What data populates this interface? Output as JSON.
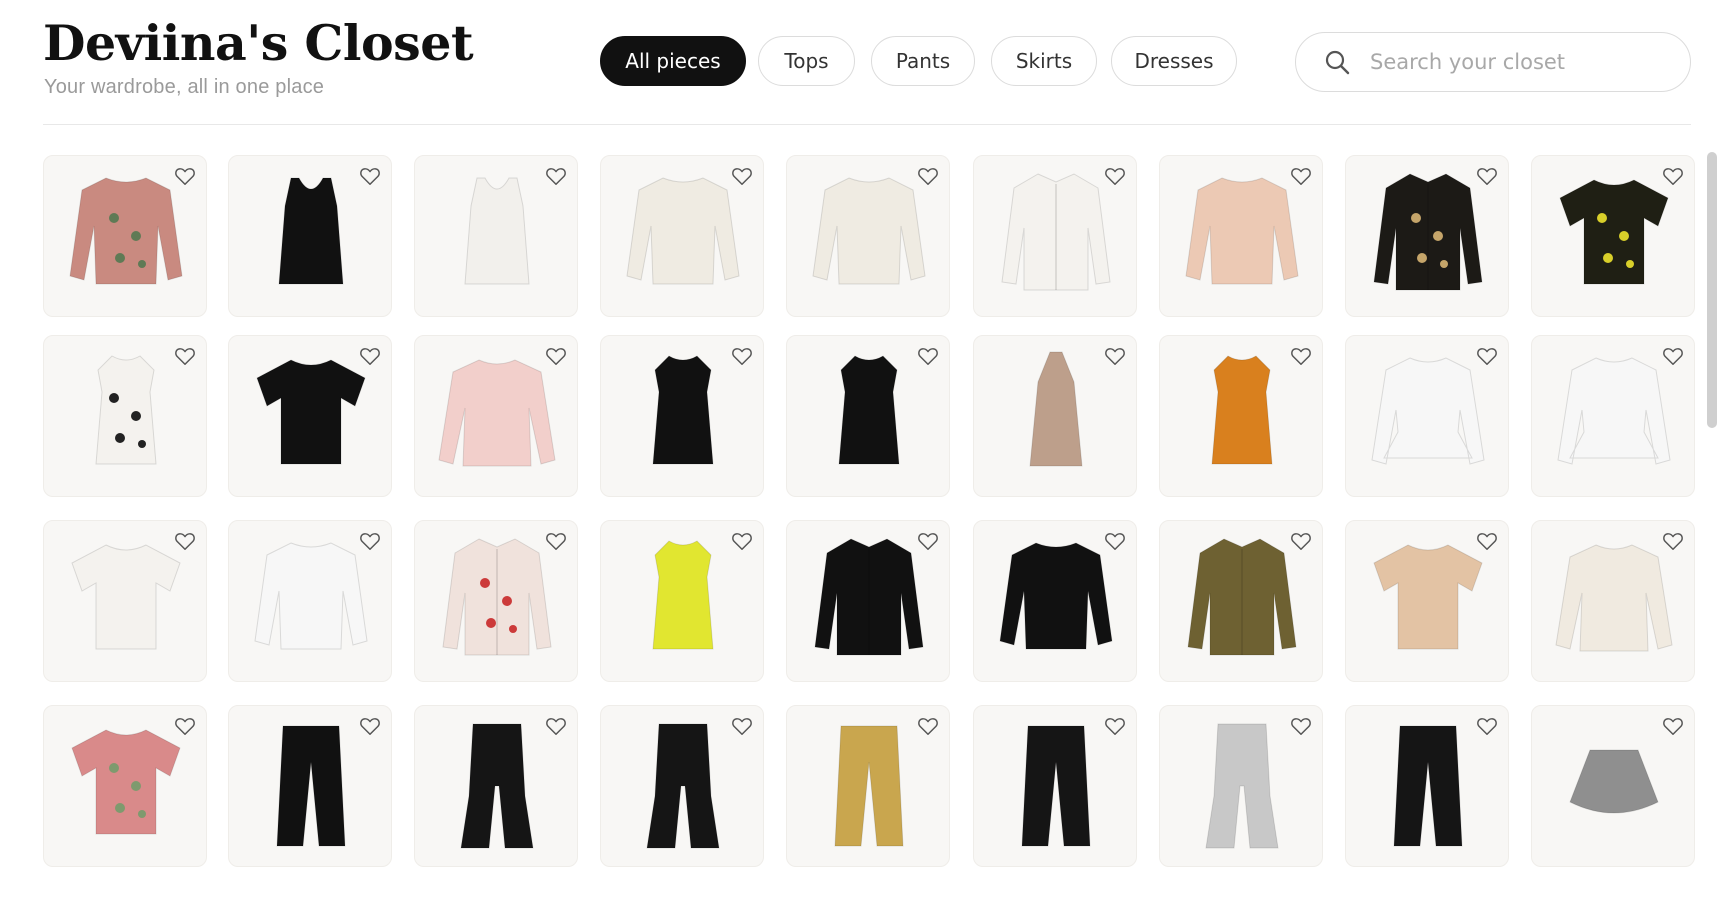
{
  "header": {
    "title": "Deviina's Closet",
    "subtitle": "Your wardrobe, all in one place"
  },
  "filters": [
    {
      "label": "All pieces",
      "active": true
    },
    {
      "label": "Tops",
      "active": false
    },
    {
      "label": "Pants",
      "active": false
    },
    {
      "label": "Skirts",
      "active": false
    },
    {
      "label": "Dresses",
      "active": false
    }
  ],
  "search": {
    "placeholder": "Search your closet",
    "value": ""
  },
  "items": [
    {
      "name": "floral-ruffle-blouse",
      "kind": "blouse",
      "color": "#c98a80",
      "accent": "#5f7a55"
    },
    {
      "name": "black-draped-tank",
      "kind": "cami",
      "color": "#111111"
    },
    {
      "name": "white-cowl-cami",
      "kind": "cami",
      "color": "#f2f0ec"
    },
    {
      "name": "cream-wrap-blouse",
      "kind": "blouse",
      "color": "#efebe2"
    },
    {
      "name": "cream-wrap-blouse-2",
      "kind": "blouse",
      "color": "#efebe2"
    },
    {
      "name": "white-button-shirt",
      "kind": "shirt",
      "color": "#f4f2ee"
    },
    {
      "name": "blush-ruched-top",
      "kind": "blouse",
      "color": "#ecc9b4"
    },
    {
      "name": "black-dotted-shirt",
      "kind": "shirt",
      "color": "#1c1a16",
      "accent": "#c5a56a"
    },
    {
      "name": "yellow-floral-tee",
      "kind": "tee",
      "color": "#1f1f14",
      "accent": "#d8cf2a"
    },
    {
      "name": "white-bow-blouse",
      "kind": "sleeveless",
      "color": "#f4f2ee",
      "accent": "#222222"
    },
    {
      "name": "black-tee",
      "kind": "tee",
      "color": "#111111"
    },
    {
      "name": "pink-sweater",
      "kind": "sweater",
      "color": "#f2cfcb"
    },
    {
      "name": "black-halter-top",
      "kind": "sleeveless",
      "color": "#111111"
    },
    {
      "name": "black-halter-top-2",
      "kind": "sleeveless",
      "color": "#111111"
    },
    {
      "name": "taupe-halter-top",
      "kind": "halter",
      "color": "#bd9f8b"
    },
    {
      "name": "orange-draped-top",
      "kind": "sleeveless",
      "color": "#d9801e"
    },
    {
      "name": "white-peplum-top",
      "kind": "peplum",
      "color": "#f7f7f7"
    },
    {
      "name": "white-peplum-jacket",
      "kind": "peplum",
      "color": "#f7f7f7"
    },
    {
      "name": "white-ruffle-tee",
      "kind": "tee",
      "color": "#f4f2ee"
    },
    {
      "name": "white-puff-blouse",
      "kind": "blouse",
      "color": "#f7f7f7"
    },
    {
      "name": "red-floral-blouse",
      "kind": "shirt",
      "color": "#f0e2dc",
      "accent": "#cc3a3a"
    },
    {
      "name": "chartreuse-cowl-top",
      "kind": "sleeveless",
      "color": "#e1e630"
    },
    {
      "name": "black-shirt",
      "kind": "shirt",
      "color": "#111111"
    },
    {
      "name": "black-ruffle-top",
      "kind": "blouse",
      "color": "#111111"
    },
    {
      "name": "olive-satin-shirt",
      "kind": "shirt",
      "color": "#6e6132"
    },
    {
      "name": "champagne-draped-tee",
      "kind": "tee",
      "color": "#e3c3a4"
    },
    {
      "name": "cream-swing-top",
      "kind": "sweater",
      "color": "#f0eae0"
    },
    {
      "name": "pink-knit-tee",
      "kind": "tee",
      "color": "#d98a8a",
      "accent": "#7e9a6e"
    },
    {
      "name": "black-jogger-pants",
      "kind": "pants",
      "color": "#111111"
    },
    {
      "name": "black-leather-flares",
      "kind": "flare",
      "color": "#151515"
    },
    {
      "name": "black-leather-flares-2",
      "kind": "flare",
      "color": "#151515"
    },
    {
      "name": "gold-wide-pants",
      "kind": "pants",
      "color": "#c9a64e"
    },
    {
      "name": "black-straight-pants",
      "kind": "pants",
      "color": "#151515"
    },
    {
      "name": "silver-flare-pants",
      "kind": "flare",
      "color": "#c8c8c8"
    },
    {
      "name": "black-leather-pants",
      "kind": "pants",
      "color": "#151515"
    },
    {
      "name": "grey-pleated-skirt",
      "kind": "skirt",
      "color": "#8f8f8f"
    }
  ]
}
